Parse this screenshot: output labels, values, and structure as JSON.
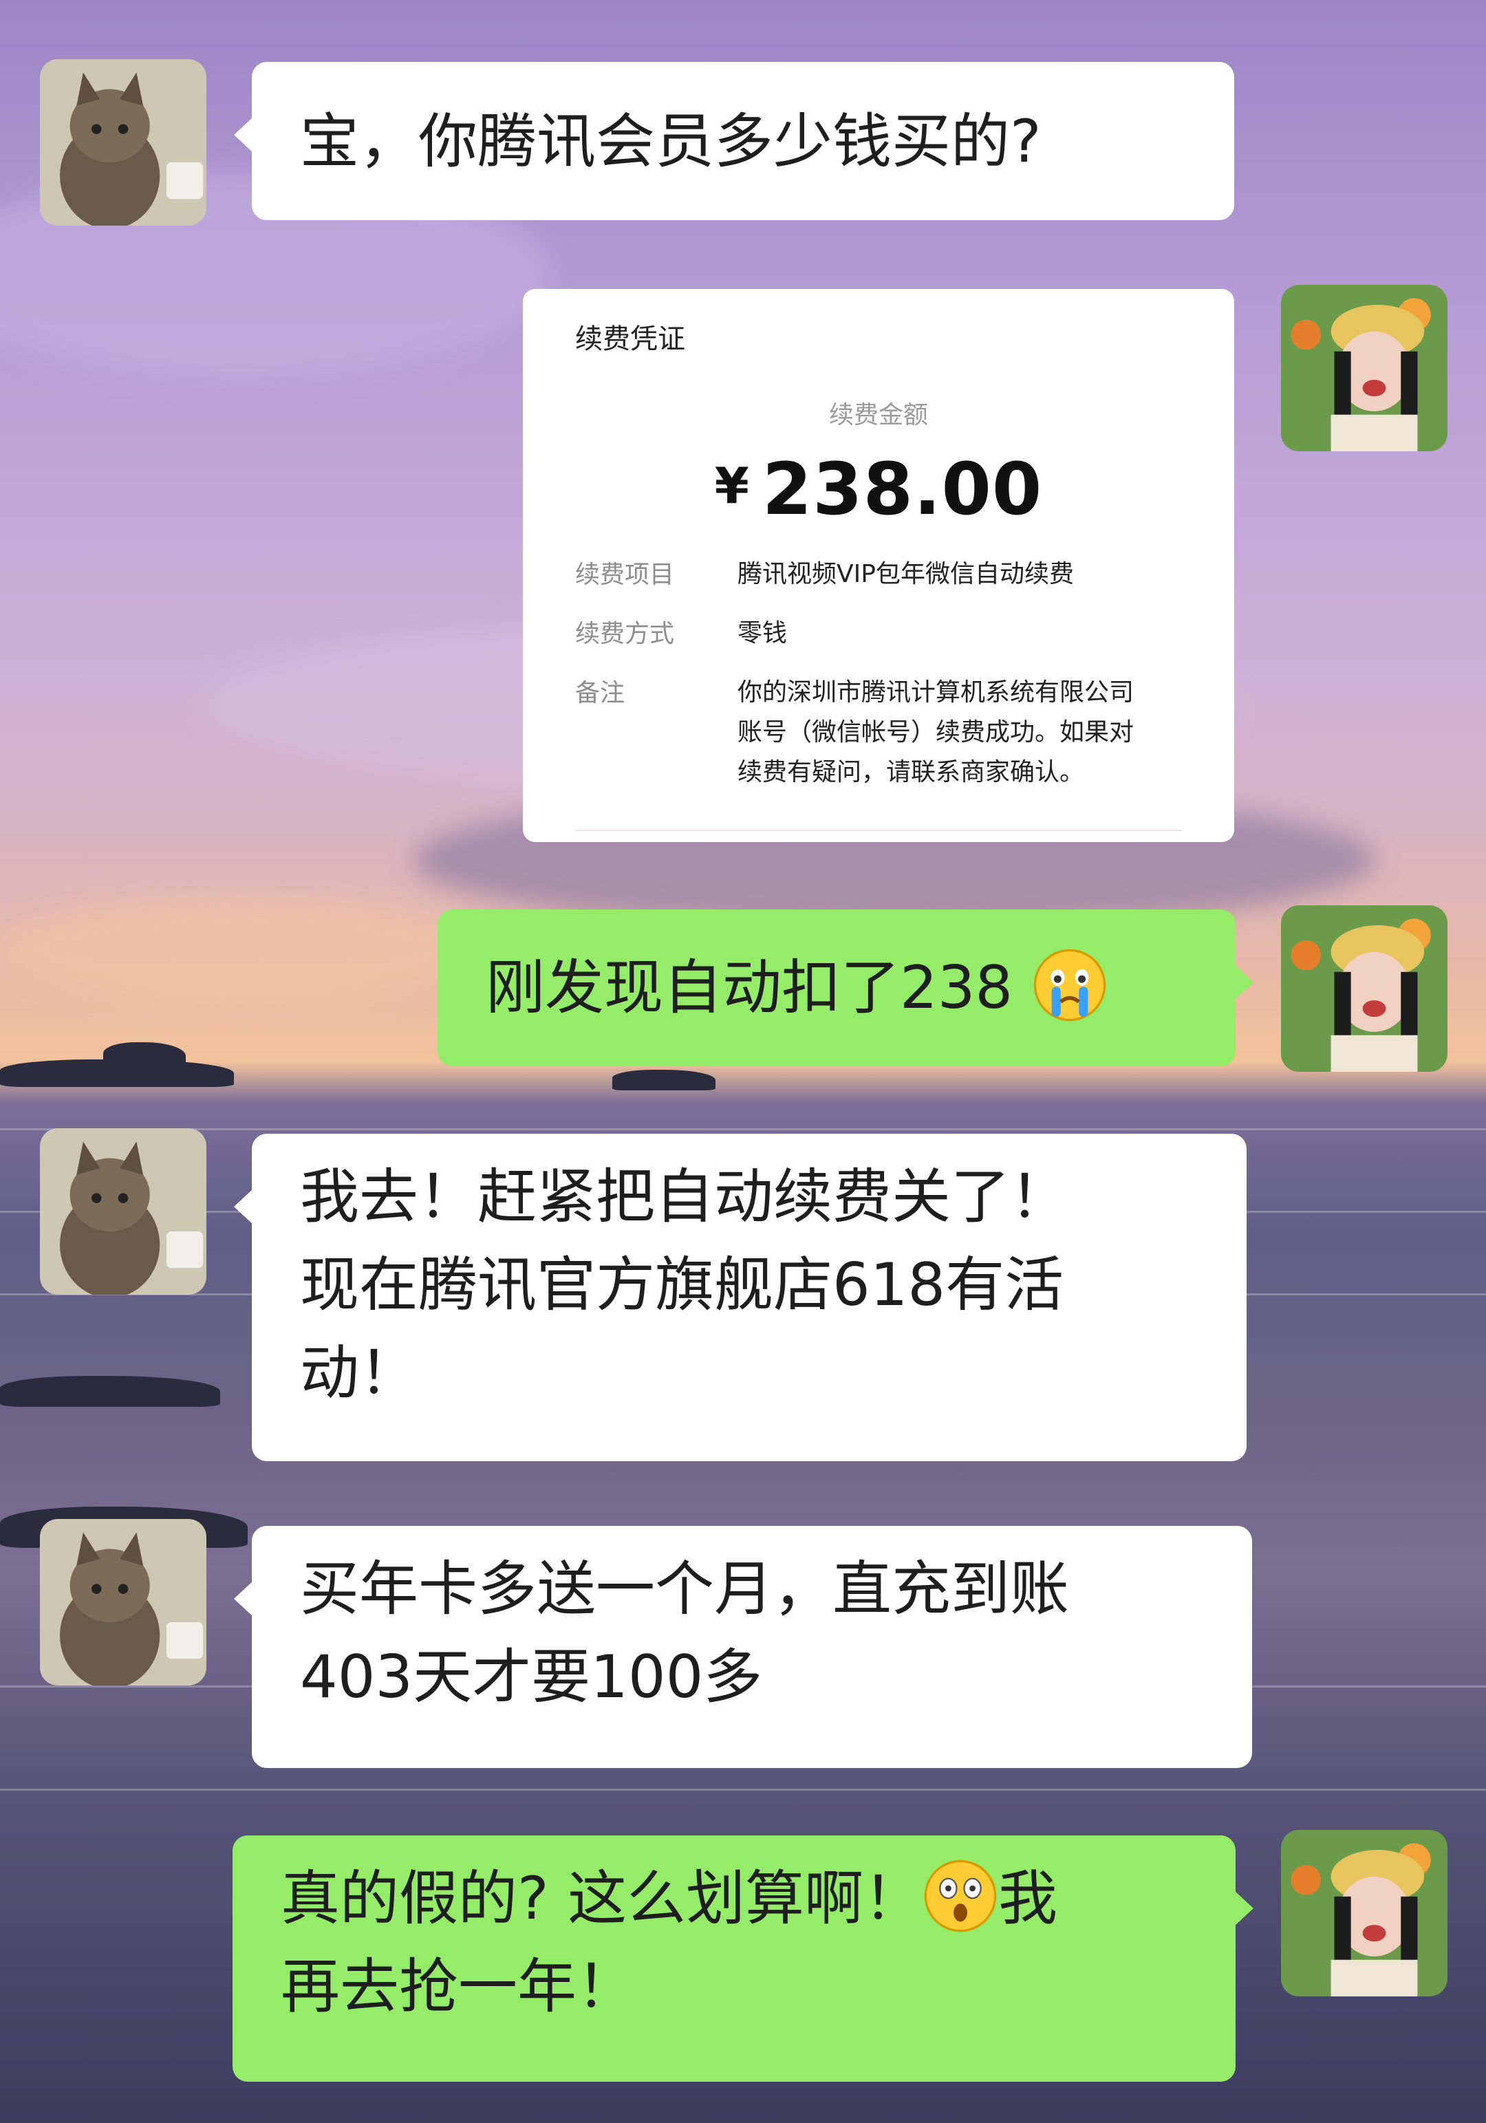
{
  "chat": {
    "messages": [
      {
        "side": "left",
        "avatar": "cat-avatar",
        "text": "宝，你腾讯会员多少钱买的?"
      },
      {
        "side": "right",
        "avatar": "girl-avatar",
        "type": "receipt"
      },
      {
        "side": "right",
        "avatar": "girl-avatar",
        "text": "刚发现自动扣了238",
        "emoji": "crying-face-emoji"
      },
      {
        "side": "left",
        "avatar": "cat-avatar",
        "lines": [
          "我去！赶紧把自动续费关了！",
          "现在腾讯官方旗舰店618有活",
          "动！"
        ]
      },
      {
        "side": "left",
        "avatar": "cat-avatar",
        "lines": [
          "买年卡多送一个月，直充到账",
          "403天才要100多"
        ]
      },
      {
        "side": "right",
        "avatar": "girl-avatar",
        "lines": [
          "真的假的? 这么划算啊！",
          "我",
          "再去抢一年！"
        ],
        "emoji": "astonished-face-emoji"
      }
    ]
  },
  "receipt": {
    "title": "续费凭证",
    "amount_label": "续费金额",
    "currency": "¥",
    "amount": "238.00",
    "rows": [
      {
        "key": "续费项目",
        "value": "腾讯视频VIP包年微信自动续费"
      },
      {
        "key": "续费方式",
        "value": "零钱"
      },
      {
        "key": "备注",
        "value_lines": [
          "你的深圳市腾讯计算机系统有限公司",
          "账号（微信帐号）续费成功。如果对",
          "续费有疑问，请联系商家确认。"
        ]
      }
    ]
  },
  "colors": {
    "green_bubble": "#95ec69",
    "white_bubble": "#ffffff"
  }
}
